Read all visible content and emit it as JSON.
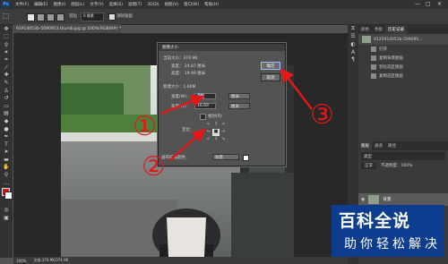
{
  "menubar": {
    "logo": "Ps",
    "items": [
      "文件(F)",
      "编辑(E)",
      "图像(I)",
      "图层(L)",
      "文字(Y)",
      "选择(S)",
      "滤镜(T)",
      "3D(D)",
      "视图(V)",
      "窗口(W)",
      "帮助(H)"
    ],
    "window_controls": [
      "—",
      "□",
      "✕"
    ]
  },
  "options_bar": {
    "feather_label": "羽化",
    "feather_value": "0 像素",
    "antialias_label": "消除锯齿"
  },
  "document": {
    "tab_title": "91914053b-5090953.thumb.jpg @ 100%(RGB/8#) *",
    "status_text": "100%",
    "status_doc": "文档:374.9K/374.9K"
  },
  "dialog": {
    "title": "图像大小",
    "current_size_label": "当前大小：374.9K",
    "current_width": "宽度：  24.87 厘米",
    "current_height": "高度：  19.49 厘米",
    "new_size_label": "新建大小：1.60M",
    "width_label": "宽度(W)：",
    "width_value": "50",
    "width_unit": "厘米",
    "height_label": "高度(H)：",
    "height_value": "16.69",
    "height_unit": "厘米",
    "relative_label": "相对(R)",
    "anchor_label": "定位：",
    "extension_label": "画布扩展颜色：",
    "extension_value": "背景",
    "ok_label": "确定",
    "cancel_label": "取消"
  },
  "history_panel": {
    "tabs": [
      "颜色",
      "色板",
      "历史记录"
    ],
    "snapshot_label": "9125914053b-509095...",
    "items": [
      "打开",
      "复制背景图层",
      "羽化选区图层",
      "复制选区图层"
    ]
  },
  "layers_panel": {
    "tabs": [
      "图层",
      "通道",
      "路径"
    ],
    "search_placeholder": "类型",
    "blend_mode": "正常",
    "opacity_label": "不透明度：100%",
    "layer_name": "背景"
  },
  "annotations": {
    "callout_1": "①",
    "callout_2": "②",
    "callout_3": "③",
    "arrow_color": "#e31919"
  },
  "watermark": {
    "title": "百科全说",
    "subtitle": "助你轻松解决",
    "bg_color": "#0d3d8e"
  }
}
